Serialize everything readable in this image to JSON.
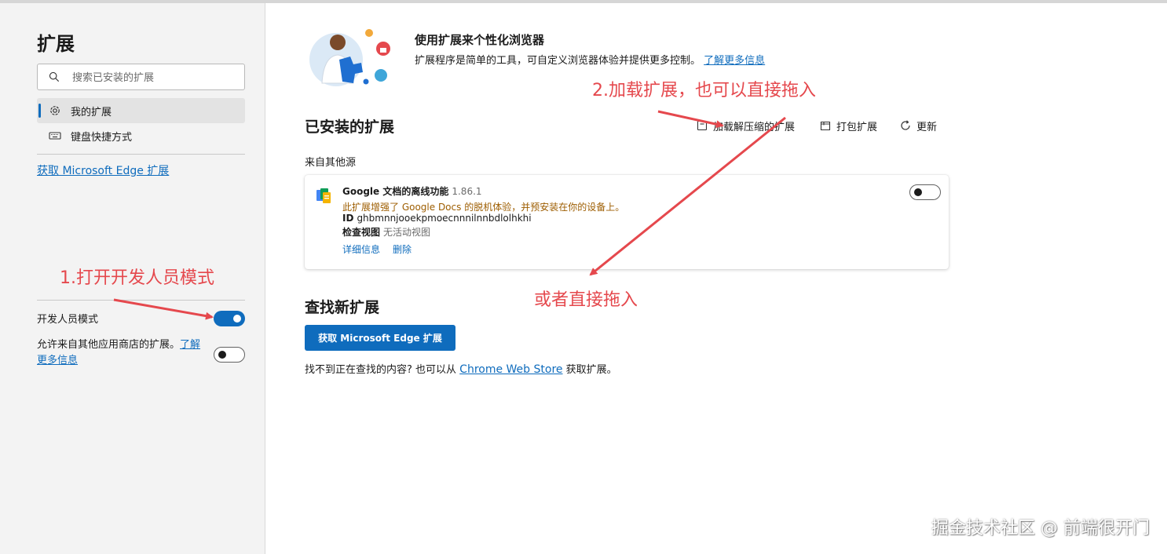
{
  "sidebar": {
    "title": "扩展",
    "search_placeholder": "搜索已安装的扩展",
    "nav": [
      {
        "label": "我的扩展"
      },
      {
        "label": "键盘快捷方式"
      }
    ],
    "get_edge_link": "获取 Microsoft Edge 扩展",
    "dev_mode_label": "开发人员模式",
    "dev_mode_on": true,
    "allow_other_text": "允许来自其他应用商店的扩展。",
    "allow_other_link": "了解更多信息",
    "allow_other_on": false
  },
  "hero": {
    "title": "使用扩展来个性化浏览器",
    "desc": "扩展程序是简单的工具，可自定义浏览器体验并提供更多控制。",
    "link": "了解更多信息"
  },
  "installed": {
    "title": "已安装的扩展",
    "actions": {
      "load": "加载解压缩的扩展",
      "pack": "打包扩展",
      "update": "更新"
    },
    "source_label": "来自其他源",
    "extension": {
      "name": "Google 文档的离线功能",
      "version": "1.86.1",
      "desc": "此扩展增强了 Google Docs 的脱机体验，并预安装在你的设备上。",
      "id_label": "ID",
      "id_value": "ghbmnnjooekpmoecnnnilnnbdlolhkhi",
      "inspect_label": "检查视图",
      "inspect_value": "无活动视图",
      "details": "详细信息",
      "remove": "删除",
      "enabled": false
    }
  },
  "find": {
    "title": "查找新扩展",
    "button": "获取 Microsoft Edge 扩展",
    "note_prefix": "找不到正在查找的内容? 也可以从 ",
    "note_link": "Chrome Web Store",
    "note_suffix": " 获取扩展。"
  },
  "annotations": {
    "step1": "1.打开开发人员模式",
    "step2": "2.加载扩展，也可以直接拖入",
    "step3": "或者直接拖入",
    "color": "#e5484d"
  },
  "watermark": "掘金技术社区 @ 前端很开门",
  "colors": {
    "accent": "#0f6cbd",
    "sidebar_bg": "#f3f3f3"
  }
}
